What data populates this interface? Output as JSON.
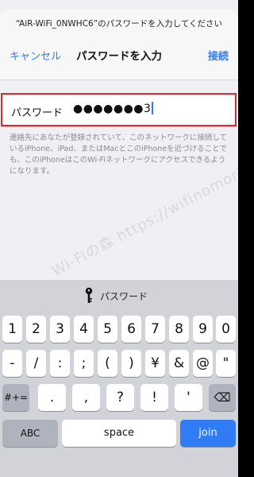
{
  "header": {
    "prompt": "“AiR-WiFi_0NWHC6”のパスワードを入力してください",
    "cancel_label": "キャンセル",
    "title": "パスワードを入力",
    "join_label": "接続"
  },
  "password": {
    "label": "パスワード",
    "value": "●●●●●●●3"
  },
  "description": "連絡先にあなたが登録されていて、このネットワークに接続しているiPhone、iPad、またはMacとこのiPhoneを近づけることでも、このiPhoneはこのWi-Fiネットワークにアクセスできるようになります。",
  "watermark": "Wi-Fiの森 https://wifinomori.com",
  "keyboard": {
    "suggestion": "パスワード",
    "row1": [
      "1",
      "2",
      "3",
      "4",
      "5",
      "6",
      "7",
      "8",
      "9",
      "0"
    ],
    "row2": [
      "-",
      "/",
      ":",
      ";",
      "(",
      ")",
      "¥",
      "&",
      "@",
      "\""
    ],
    "row3_shift": "#+=",
    "row3": [
      ".",
      ",",
      "?",
      "!",
      "'"
    ],
    "row3_delete": "⌫",
    "abc": "ABC",
    "space": "space",
    "join": "join"
  },
  "colors": {
    "accent": "#2f7cf6",
    "highlight_border": "#e0262f"
  }
}
